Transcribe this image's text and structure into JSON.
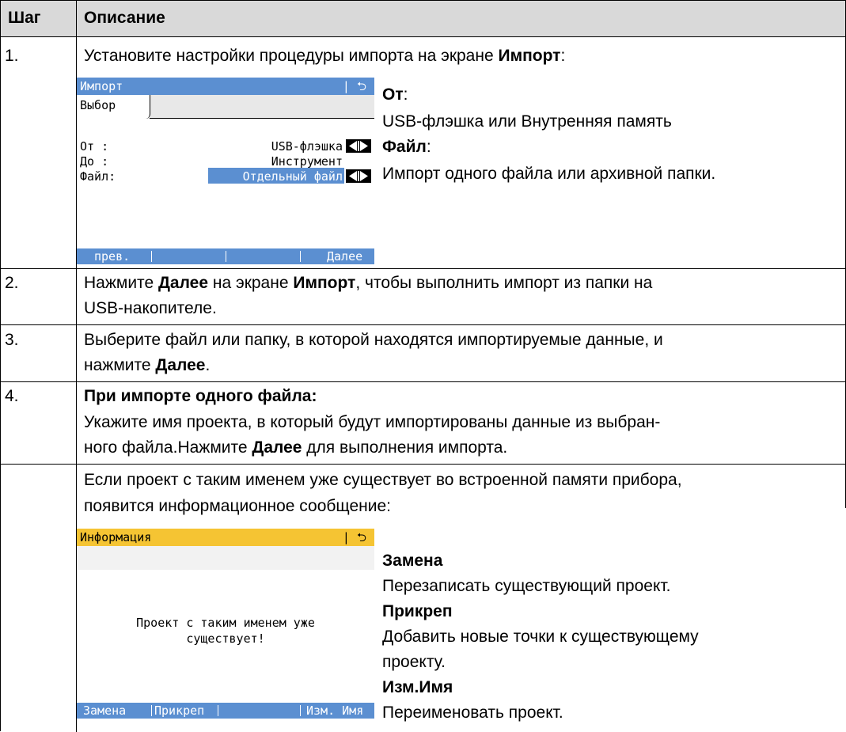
{
  "table": {
    "header": {
      "step": "Шаг",
      "description": "Описание"
    },
    "rows": [
      {
        "step": "1.",
        "intro_pre": "Установите настройки процедуры импорта на экране ",
        "intro_bold": "Импорт",
        "intro_post": ":",
        "screen": {
          "title": "Импорт",
          "back_symbol": "| ⮌",
          "tab": "Выбор",
          "fields": [
            {
              "label": "От   :",
              "value": "USB-флэшка"
            },
            {
              "label": "До   :",
              "value": "Инструмент"
            },
            {
              "label": "Файл:",
              "value": "Отдельный файл"
            }
          ],
          "softkeys": [
            "прев.",
            "",
            "",
            "Далее"
          ]
        },
        "notes": [
          {
            "term": "От",
            "term_suffix": ":",
            "text": "USB-флэшка или Внутренняя память"
          },
          {
            "term": "Файл",
            "term_suffix": ":",
            "text": "Импорт одного файла или архивной папки."
          }
        ]
      },
      {
        "step": "2.",
        "p1": "Нажмите ",
        "b1": "Далее",
        "p2": " на экране ",
        "b2": "Импорт",
        "p3": ", чтобы выполнить импорт из папки на",
        "line2": "USB-накопителе."
      },
      {
        "step": "3.",
        "line1": "Выберите файл или папку, в которой находятся импортируемые данные, и",
        "line2_pre": "нажмите ",
        "line2_bold": "Далее",
        "line2_post": "."
      },
      {
        "step": "4.",
        "heading": "При импорте одного файла:",
        "line1": "Укажите имя проекта, в который будут импортированы данные из выбран-",
        "line2_pre": "ного файла.Нажмите ",
        "line2_bold": "Далее",
        "line2_post": " для выполнения импорта."
      },
      {
        "step": "",
        "line1": "Если проект с таким именем уже существует во встроенной памяти прибора,",
        "line2": "появится информационное сообщение:",
        "screen": {
          "title": "Информация",
          "back_symbol": "| ⮌",
          "message_line1": "Проект с таким именем уже",
          "message_line2": "существует!",
          "softkeys": [
            "Замена",
            "Прикреп",
            "",
            "Изм. Имя"
          ]
        },
        "notes": [
          {
            "term": "Замена",
            "text": "Перезаписать существующий проект."
          },
          {
            "term": "Прикреп",
            "text_line1": "Добавить новые точки к существующему",
            "text_line2": "проекту."
          },
          {
            "term": "Изм.Имя",
            "text": "Переименовать проект."
          }
        ]
      }
    ]
  }
}
